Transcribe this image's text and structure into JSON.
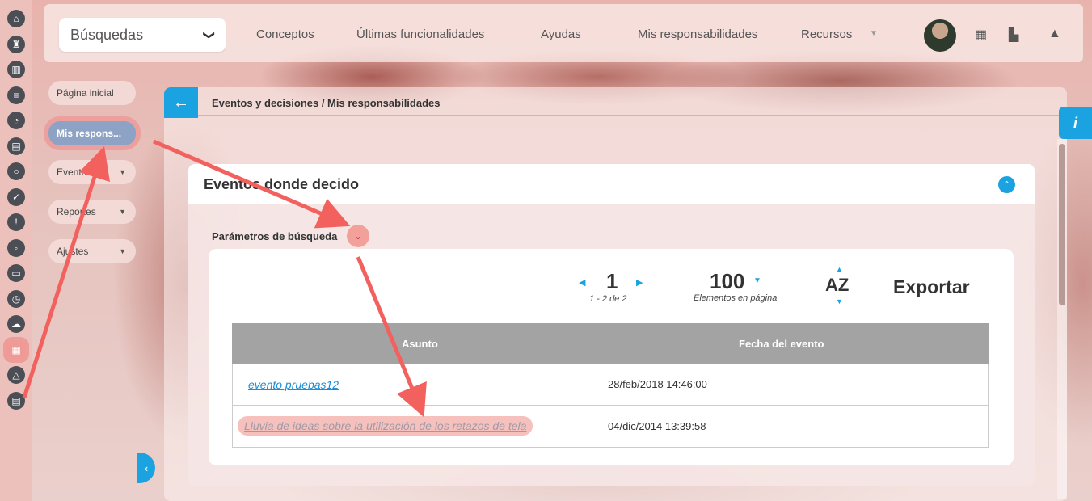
{
  "rail": {
    "icons": [
      "home-icon",
      "chess-rook-icon",
      "bar-chart-icon",
      "align-icon",
      "pie-chart-icon",
      "document-icon",
      "cycle-icon",
      "check-circle-icon",
      "warning-icon",
      "toggle-icon",
      "monitor-icon",
      "clock-icon",
      "cloud-icon",
      "calendar-icon",
      "network-icon",
      "list-document-icon"
    ],
    "glyphs": [
      "⌂",
      "♜",
      "▥",
      "≡",
      "◔",
      "▤",
      "○",
      "✓",
      "!",
      "◦",
      "▭",
      "◷",
      "☁",
      "▦",
      "△",
      "▤"
    ],
    "active_index": 13
  },
  "topbar": {
    "search_select": "Búsquedas",
    "chevron": "❯",
    "nav": [
      "Conceptos",
      "Últimas funcionalidades",
      "Ayudas",
      "Mis responsabilidades",
      "Recursos"
    ],
    "nav_caret": "▼",
    "icons": [
      "calendar-icon",
      "library-icon",
      "bell-icon"
    ],
    "icon_glyphs": [
      "▦",
      "▙",
      "▲"
    ]
  },
  "submenu": [
    {
      "label": "Página inicial",
      "has_dropdown": false
    },
    {
      "label": "Mis respons...",
      "has_dropdown": false,
      "active": true
    },
    {
      "label": "Eventos",
      "has_dropdown": true
    },
    {
      "label": "Reportes",
      "has_dropdown": true
    },
    {
      "label": "Ajustes",
      "has_dropdown": true
    }
  ],
  "dropdown_glyph": "▼",
  "collapse_glyph": "‹",
  "back_glyph": "←",
  "breadcrumb": "Eventos y decisiones / Mis responsabilidades",
  "info_glyph": "i",
  "card": {
    "title": "Eventos donde decido",
    "toggle_glyph": "⌃",
    "params_label": "Parámetros de búsqueda",
    "params_glyph": "⌄"
  },
  "pager": {
    "prev": "◀",
    "next": "▶",
    "page": "1",
    "range": "1 - 2 de 2",
    "per_page": "100",
    "per_page_caret": "▼",
    "per_page_label": "Elementos en página",
    "sort_label": "AZ",
    "sort_up": "▲",
    "sort_down": "▼",
    "export": "Exportar"
  },
  "grid": {
    "columns": [
      "Asunto",
      "Fecha del evento"
    ],
    "rows": [
      {
        "asunto": "evento pruebas12",
        "fecha": "28/feb/2018 14:46:00"
      },
      {
        "asunto": "Lluvia de ideas sobre la utilización de los retazos de tela",
        "fecha": "04/dic/2014 13:39:58"
      }
    ]
  },
  "colors": {
    "accent": "#1aa3e0",
    "annotation_arrow": "#f2615e",
    "grid_header": "#a3a3a3",
    "link": "#1a8ed6"
  }
}
